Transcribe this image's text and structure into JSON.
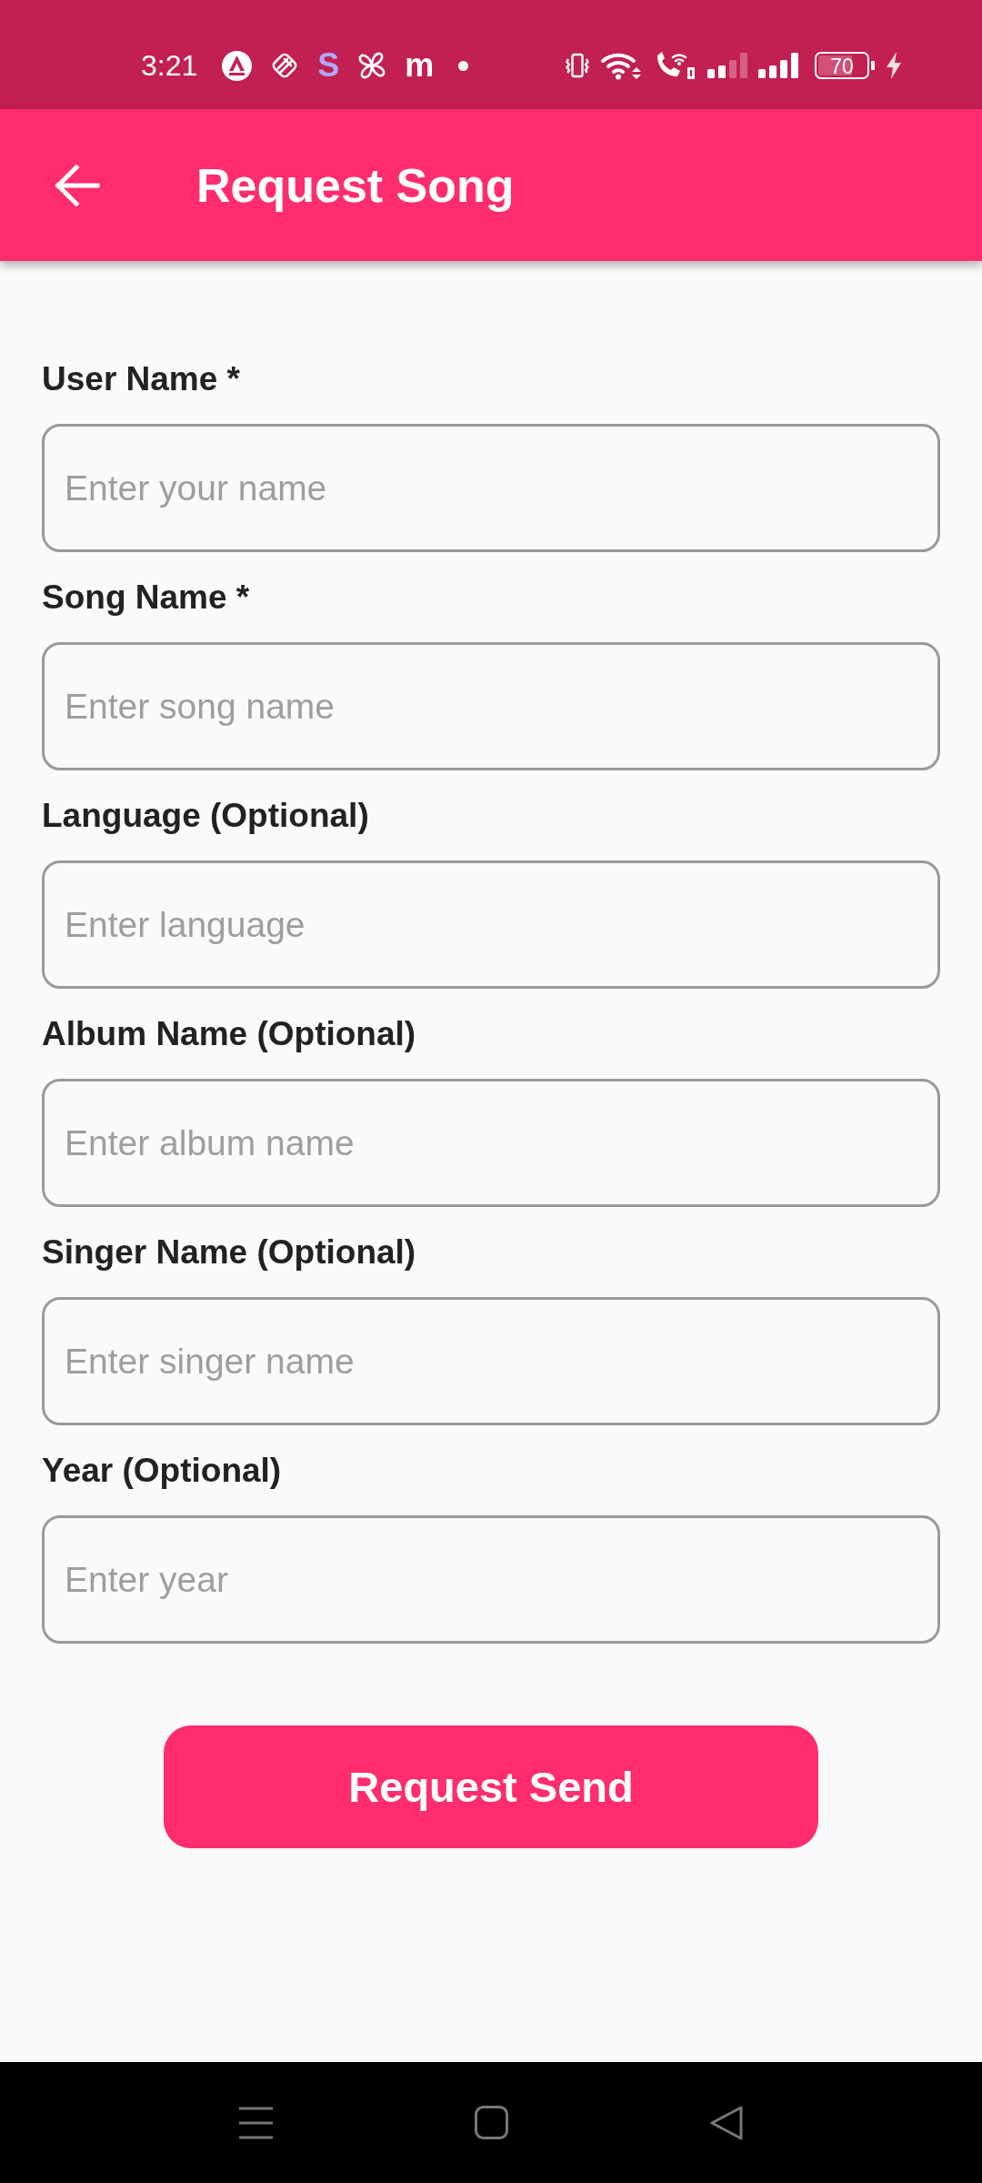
{
  "status_bar": {
    "time": "3:21",
    "notification_letters": [
      {
        "text": "S",
        "color": "#b0a8ff"
      },
      {
        "text": "m",
        "color": "#ffffff"
      }
    ],
    "battery": "70"
  },
  "app_bar": {
    "title": "Request Song"
  },
  "fields": [
    {
      "label": "User Name *",
      "placeholder": "Enter your name"
    },
    {
      "label": "Song Name *",
      "placeholder": "Enter song name"
    },
    {
      "label": "Language (Optional)",
      "placeholder": "Enter language"
    },
    {
      "label": "Album Name (Optional)",
      "placeholder": "Enter album name"
    },
    {
      "label": "Singer Name (Optional)",
      "placeholder": "Enter singer name"
    },
    {
      "label": "Year (Optional)",
      "placeholder": "Enter year"
    }
  ],
  "submit_button": {
    "label": "Request Send"
  }
}
